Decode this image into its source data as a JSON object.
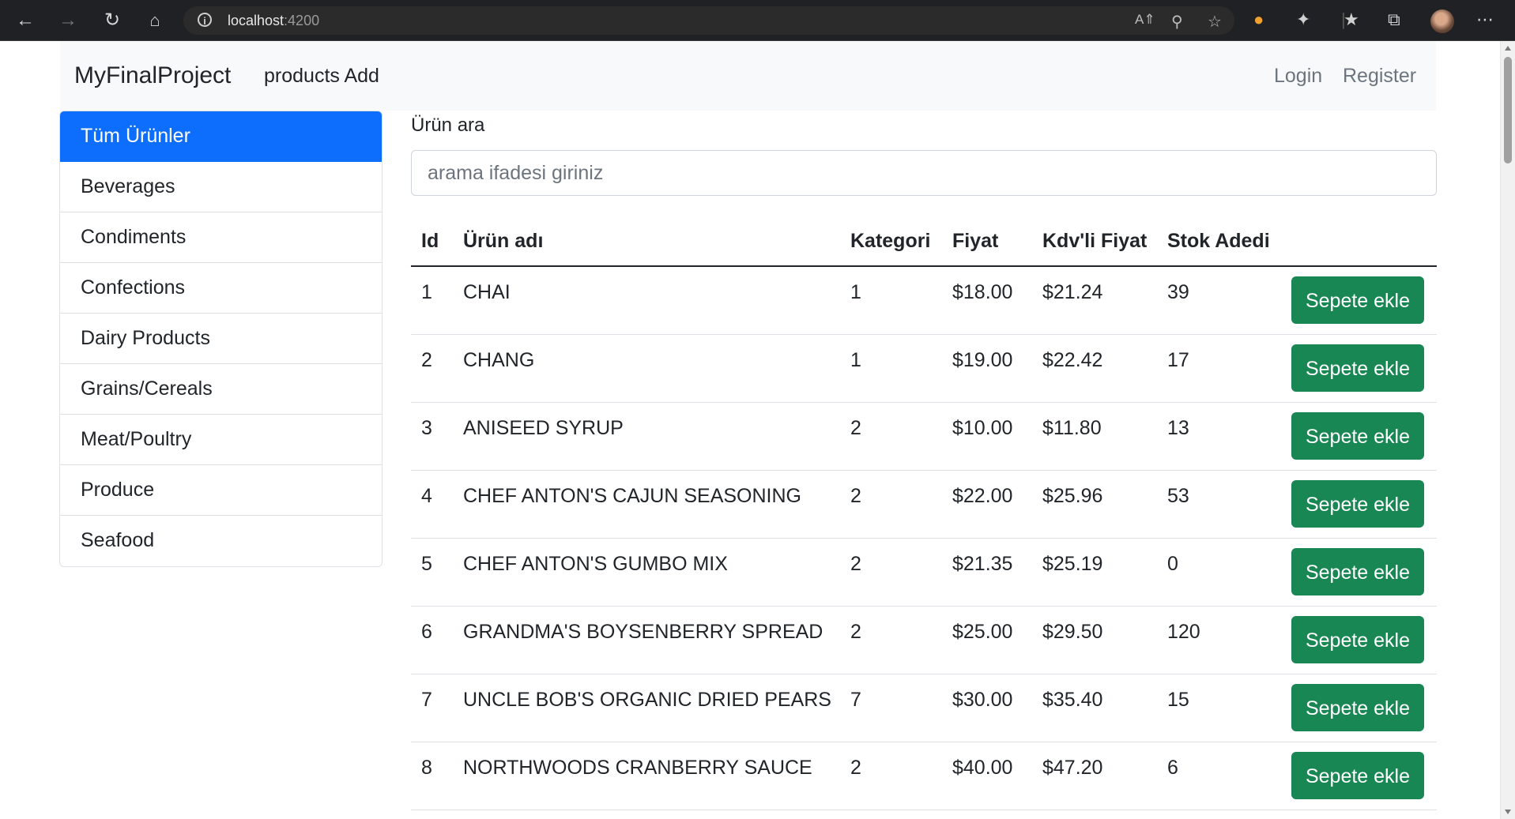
{
  "browser": {
    "url_host": "localhost",
    "url_port": ":4200",
    "icons": [
      "back-arrow-icon",
      "forward-arrow-icon",
      "reload-icon",
      "home-icon",
      "info-icon",
      "read-aloud-icon",
      "zoom-icon",
      "favorite-add-icon",
      "extension-icon",
      "puzzle-icon",
      "favorites-icon",
      "collections-icon",
      "profile-avatar",
      "more-icon"
    ]
  },
  "navbar": {
    "brand": "MyFinalProject",
    "products_add": "products Add",
    "login": "Login",
    "register": "Register"
  },
  "categories": [
    "Tüm Ürünler",
    "Beverages",
    "Condiments",
    "Confections",
    "Dairy Products",
    "Grains/Cereals",
    "Meat/Poultry",
    "Produce",
    "Seafood"
  ],
  "search": {
    "label": "Ürün ara",
    "placeholder": "arama ifadesi giriniz"
  },
  "table": {
    "headers": [
      "Id",
      "Ürün adı",
      "Kategori",
      "Fiyat",
      "Kdv'li Fiyat",
      "Stok Adedi"
    ],
    "button_label": "Sepete ekle",
    "rows": [
      {
        "id": "1",
        "name": "CHAI",
        "category": "1",
        "price": "$18.00",
        "kdv_price": "$21.24",
        "stock": "39"
      },
      {
        "id": "2",
        "name": "CHANG",
        "category": "1",
        "price": "$19.00",
        "kdv_price": "$22.42",
        "stock": "17"
      },
      {
        "id": "3",
        "name": "ANISEED SYRUP",
        "category": "2",
        "price": "$10.00",
        "kdv_price": "$11.80",
        "stock": "13"
      },
      {
        "id": "4",
        "name": "CHEF ANTON'S CAJUN SEASONING",
        "category": "2",
        "price": "$22.00",
        "kdv_price": "$25.96",
        "stock": "53"
      },
      {
        "id": "5",
        "name": "CHEF ANTON'S GUMBO MIX",
        "category": "2",
        "price": "$21.35",
        "kdv_price": "$25.19",
        "stock": "0"
      },
      {
        "id": "6",
        "name": "GRANDMA'S BOYSENBERRY SPREAD",
        "category": "2",
        "price": "$25.00",
        "kdv_price": "$29.50",
        "stock": "120"
      },
      {
        "id": "7",
        "name": "UNCLE BOB'S ORGANIC DRIED PEARS",
        "category": "7",
        "price": "$30.00",
        "kdv_price": "$35.40",
        "stock": "15"
      },
      {
        "id": "8",
        "name": "NORTHWOODS CRANBERRY SAUCE",
        "category": "2",
        "price": "$40.00",
        "kdv_price": "$47.20",
        "stock": "6"
      }
    ]
  },
  "colors": {
    "primary": "#0d6efd",
    "success": "#198754",
    "navbar_bg": "#f8f9fa",
    "muted_link": "#6c757d"
  }
}
